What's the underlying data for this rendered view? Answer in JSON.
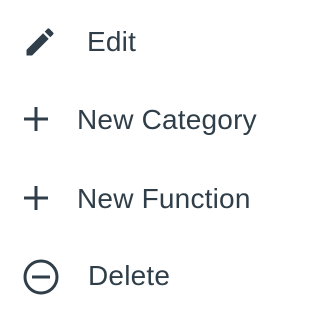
{
  "colors": {
    "text": "#2f3e48",
    "background": "#ffffff"
  },
  "menu": {
    "items": [
      {
        "label": "Edit",
        "icon": "pencil-icon"
      },
      {
        "label": "New Category",
        "icon": "plus-icon"
      },
      {
        "label": "New Function",
        "icon": "plus-icon"
      },
      {
        "label": "Delete",
        "icon": "minus-circle-icon"
      }
    ]
  }
}
